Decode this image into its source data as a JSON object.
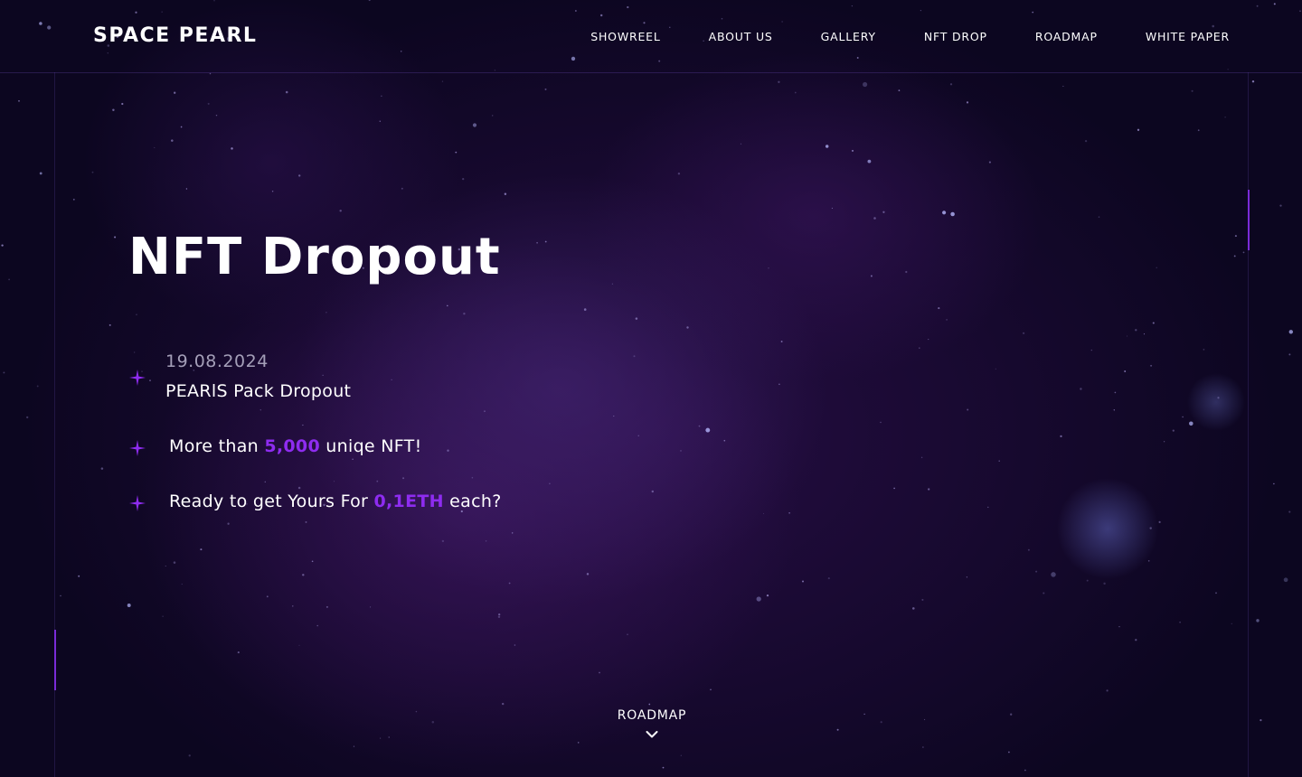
{
  "header": {
    "logo": "SPACE PEARL",
    "nav": [
      {
        "label": "SHOWREEL"
      },
      {
        "label": "ABOUT US"
      },
      {
        "label": "GALLERY"
      },
      {
        "label": "NFT DROP"
      },
      {
        "label": "ROADMAP"
      },
      {
        "label": "WHITE PAPER"
      }
    ]
  },
  "hero": {
    "title": "NFT Dropout",
    "items": [
      {
        "date": "19.08.2024",
        "title": "PEARlS Pack Dropout"
      },
      {
        "prefix": "More than ",
        "highlight": "5,000",
        "suffix": " uniqe NFT!"
      },
      {
        "prefix": "Ready to get Yours For ",
        "highlight": "0,1ETH",
        "suffix": " each?"
      }
    ]
  },
  "scroll": {
    "label": "ROADMAP",
    "icon": "chevron-down-icon"
  },
  "colors": {
    "accent": "#8e2cf0",
    "background": "#0d0622",
    "text": "#ffffff",
    "muted": "#a49fb8"
  }
}
